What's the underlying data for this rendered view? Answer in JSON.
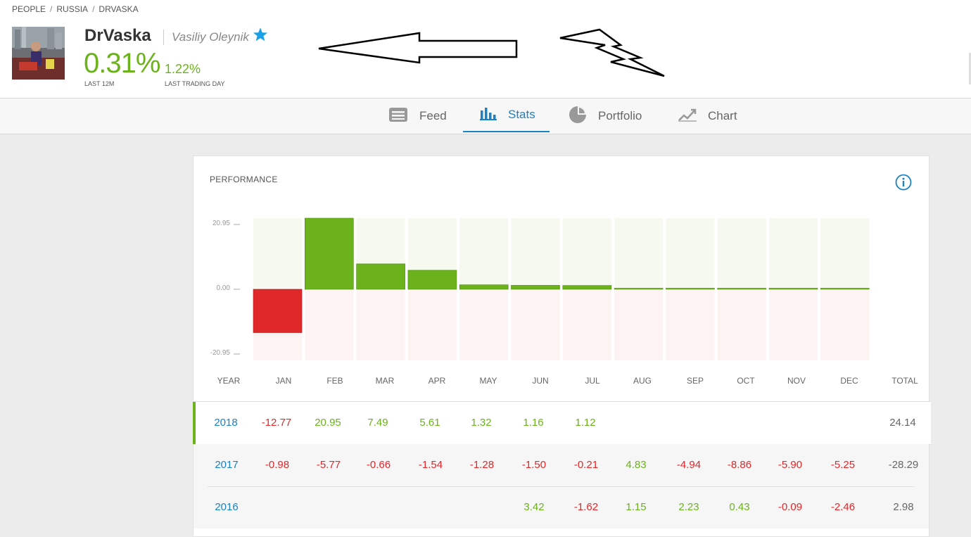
{
  "breadcrumb": [
    "PEOPLE",
    "RUSSIA",
    "DRVASKA"
  ],
  "profile": {
    "username": "DrVaska",
    "real_name": "Vasiliy Oleynik",
    "gain_12m": "0.31%",
    "gain_day": "1.22%",
    "label_12m": "LAST 12M",
    "label_day": "LAST TRADING DAY"
  },
  "tabs": [
    {
      "label": "Feed",
      "icon": "feed-icon"
    },
    {
      "label": "Stats",
      "icon": "stats-bar-icon"
    },
    {
      "label": "Portfolio",
      "icon": "pie-chart-icon"
    },
    {
      "label": "Chart",
      "icon": "line-chart-icon"
    }
  ],
  "active_tab": "Stats",
  "colors": {
    "accent": "#1a82c5",
    "positive": "#6cb21c",
    "negative": "#e0282a"
  },
  "performance": {
    "title": "PERFORMANCE",
    "y_ticks": [
      "20.95",
      "0.00",
      "-20.95"
    ],
    "headers": [
      "YEAR",
      "JAN",
      "FEB",
      "MAR",
      "APR",
      "MAY",
      "JUN",
      "JUL",
      "AUG",
      "SEP",
      "OCT",
      "NOV",
      "DEC",
      "TOTAL"
    ],
    "rows": [
      {
        "year": "2018",
        "values": [
          "-12.77",
          "20.95",
          "7.49",
          "5.61",
          "1.32",
          "1.16",
          "1.12",
          "",
          "",
          "",
          "",
          ""
        ],
        "total": "24.14"
      },
      {
        "year": "2017",
        "values": [
          "-0.98",
          "-5.77",
          "-0.66",
          "-1.54",
          "-1.28",
          "-1.50",
          "-0.21",
          "4.83",
          "-4.94",
          "-8.86",
          "-5.90",
          "-5.25"
        ],
        "total": "-28.29"
      },
      {
        "year": "2016",
        "values": [
          "",
          "",
          "",
          "",
          "",
          "3.42",
          "-1.62",
          "1.15",
          "2.23",
          "0.43",
          "-0.09",
          "-2.46"
        ],
        "total": "2.98"
      }
    ]
  },
  "chart_data": {
    "type": "bar",
    "title": "PERFORMANCE",
    "categories": [
      "JAN",
      "FEB",
      "MAR",
      "APR",
      "MAY",
      "JUN",
      "JUL",
      "AUG",
      "SEP",
      "OCT",
      "NOV",
      "DEC"
    ],
    "values": [
      -12.77,
      20.95,
      7.49,
      5.61,
      1.32,
      1.16,
      1.12,
      0,
      0,
      0,
      0,
      0
    ],
    "ylim": [
      -20.95,
      20.95
    ]
  }
}
